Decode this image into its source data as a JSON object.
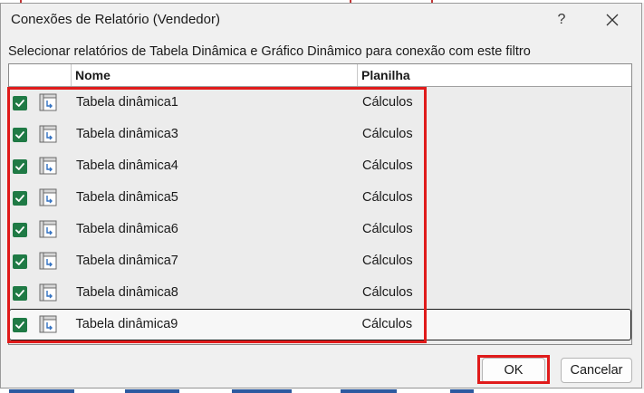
{
  "dialog": {
    "title": "Conexões de Relatório (Vendedor)",
    "help_label": "?",
    "close_icon": "close-icon",
    "instruction": "Selecionar relatórios de Tabela Dinâmica e Gráfico Dinâmico para conexão com este filtro"
  },
  "table": {
    "columns": [
      "",
      "Nome",
      "Planilha"
    ],
    "rows": [
      {
        "checked": true,
        "name": "Tabela dinâmica1",
        "sheet": "Cálculos"
      },
      {
        "checked": true,
        "name": "Tabela dinâmica3",
        "sheet": "Cálculos"
      },
      {
        "checked": true,
        "name": "Tabela dinâmica4",
        "sheet": "Cálculos"
      },
      {
        "checked": true,
        "name": "Tabela dinâmica5",
        "sheet": "Cálculos"
      },
      {
        "checked": true,
        "name": "Tabela dinâmica6",
        "sheet": "Cálculos"
      },
      {
        "checked": true,
        "name": "Tabela dinâmica7",
        "sheet": "Cálculos"
      },
      {
        "checked": true,
        "name": "Tabela dinâmica8",
        "sheet": "Cálculos"
      },
      {
        "checked": true,
        "name": "Tabela dinâmica9",
        "sheet": "Cálculos",
        "selected": true
      }
    ]
  },
  "buttons": {
    "ok_label": "OK",
    "cancel_label": "Cancelar"
  },
  "colors": {
    "checkbox": "#1f7a45",
    "highlight": "#e01b1b",
    "dialog_bg": "#f0f0f0"
  }
}
